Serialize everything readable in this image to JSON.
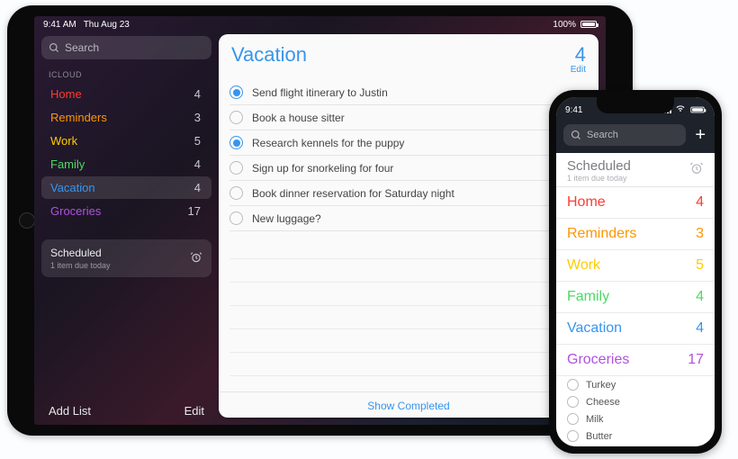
{
  "ipad": {
    "status": {
      "time": "9:41 AM",
      "date": "Thu Aug 23",
      "battery_pct": "100%"
    },
    "sidebar": {
      "search_placeholder": "Search",
      "section_label": "ICLOUD",
      "lists": [
        {
          "name": "Home",
          "count": "4",
          "color": "#ff3b30",
          "selected": false
        },
        {
          "name": "Reminders",
          "count": "3",
          "color": "#ff9500",
          "selected": false
        },
        {
          "name": "Work",
          "count": "5",
          "color": "#ffcc00",
          "selected": false
        },
        {
          "name": "Family",
          "count": "4",
          "color": "#4cd964",
          "selected": false
        },
        {
          "name": "Vacation",
          "count": "4",
          "color": "#3795ee",
          "selected": true
        },
        {
          "name": "Groceries",
          "count": "17",
          "color": "#af52de",
          "selected": false
        }
      ],
      "scheduled": {
        "title": "Scheduled",
        "subtitle": "1 item due today"
      },
      "footer": {
        "add_list": "Add List",
        "edit": "Edit"
      }
    },
    "detail": {
      "title": "Vacation",
      "count": "4",
      "edit_label": "Edit",
      "items": [
        {
          "text": "Send flight itinerary to Justin",
          "checked": true
        },
        {
          "text": "Book a house sitter",
          "checked": false
        },
        {
          "text": "Research kennels for the puppy",
          "checked": true
        },
        {
          "text": "Sign up for snorkeling for four",
          "checked": false
        },
        {
          "text": "Book dinner reservation for Saturday night",
          "checked": false
        },
        {
          "text": "New luggage?",
          "checked": false
        }
      ],
      "footer": "Show Completed"
    }
  },
  "iphone": {
    "status": {
      "time": "9:41"
    },
    "search_placeholder": "Search",
    "scheduled": {
      "title": "Scheduled",
      "subtitle": "1 item due today"
    },
    "lists": [
      {
        "name": "Home",
        "count": "4",
        "color": "#ff3b30"
      },
      {
        "name": "Reminders",
        "count": "3",
        "color": "#ff9500"
      },
      {
        "name": "Work",
        "count": "5",
        "color": "#ffcc00"
      },
      {
        "name": "Family",
        "count": "4",
        "color": "#4cd964"
      },
      {
        "name": "Vacation",
        "count": "4",
        "color": "#3795ee"
      },
      {
        "name": "Groceries",
        "count": "17",
        "color": "#af52de"
      }
    ],
    "groceries_items": [
      {
        "text": "Turkey"
      },
      {
        "text": "Cheese"
      },
      {
        "text": "Milk"
      },
      {
        "text": "Butter"
      }
    ]
  }
}
